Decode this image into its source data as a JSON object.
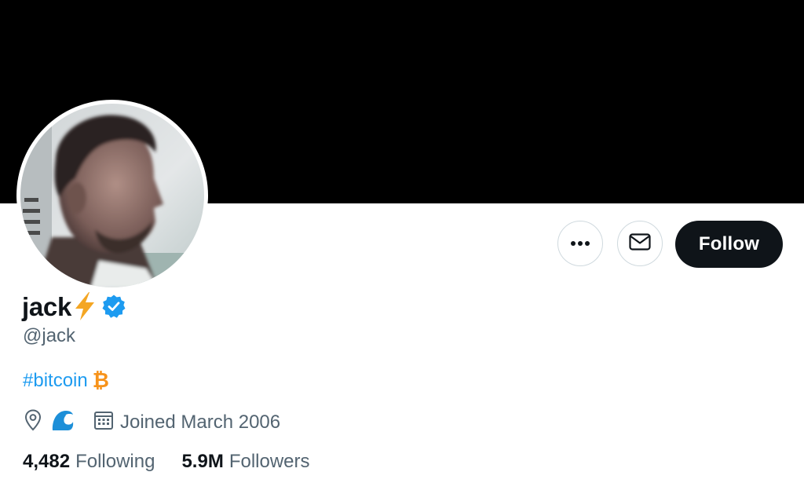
{
  "profile": {
    "display_name": "jack",
    "name_emoji": "lightning-bolt",
    "verified": true,
    "handle": "@jack",
    "bio_hashtag": "#bitcoin",
    "bio_symbol": "₿",
    "location_emoji": "water-wave",
    "joined": "Joined March 2006"
  },
  "stats": {
    "following_count": "4,482",
    "following_label": "Following",
    "followers_count": "5.9M",
    "followers_label": "Followers"
  },
  "actions": {
    "follow_label": "Follow",
    "more_icon": "ellipsis-icon",
    "message_icon": "envelope-icon"
  },
  "colors": {
    "banner": "#000000",
    "link": "#1d9bf0",
    "secondary_text": "#536471",
    "follow_button": "#0f1419",
    "bitcoin": "#f7931a",
    "verified_badge": "#1d9bf0",
    "lightning": "#f4a623"
  }
}
